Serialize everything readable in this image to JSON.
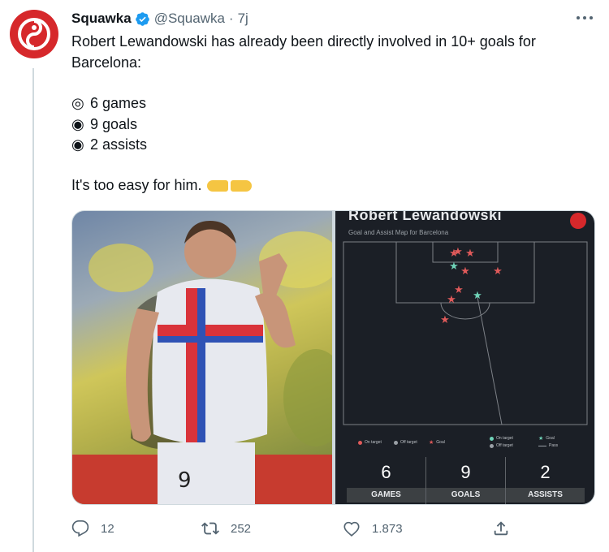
{
  "tweet": {
    "author_name": "Squawka",
    "handle": "@Squawka",
    "separator": "·",
    "time": "7j",
    "text_line1": "Robert Lewandowski has already been directly involved in 10+ goals for",
    "text_line2": "Barcelona:",
    "bullets": [
      {
        "symbol": "◎",
        "text": "6 games"
      },
      {
        "symbol": "◉",
        "text": "9 goals"
      },
      {
        "symbol": "◉",
        "text": "2 assists"
      }
    ],
    "closing": "It's too easy for him."
  },
  "card": {
    "title": "Robert Lewandowski",
    "subtitle": "Goal and Assist Map for Barcelona",
    "legend": {
      "on_target": "On target",
      "off_target": "Off target",
      "goal": "Goal",
      "on_target_2": "On target",
      "off_target_2": "Off target",
      "goal_2": "Goal",
      "pass": "Pass"
    },
    "stats": [
      {
        "value": "6",
        "label": "GAMES"
      },
      {
        "value": "9",
        "label": "GOALS"
      },
      {
        "value": "2",
        "label": "ASSISTS"
      }
    ]
  },
  "actions": {
    "replies": "12",
    "retweets": "252",
    "likes": "1.873"
  },
  "colors": {
    "brand_red": "#d6282b",
    "verified_blue": "#1d9bf0",
    "goal_star": "#e05a5a",
    "assist_star": "#6fd3b8"
  },
  "icons": [
    "verified-badge-icon",
    "more-icon",
    "reply-icon",
    "retweet-icon",
    "like-icon",
    "share-icon"
  ]
}
